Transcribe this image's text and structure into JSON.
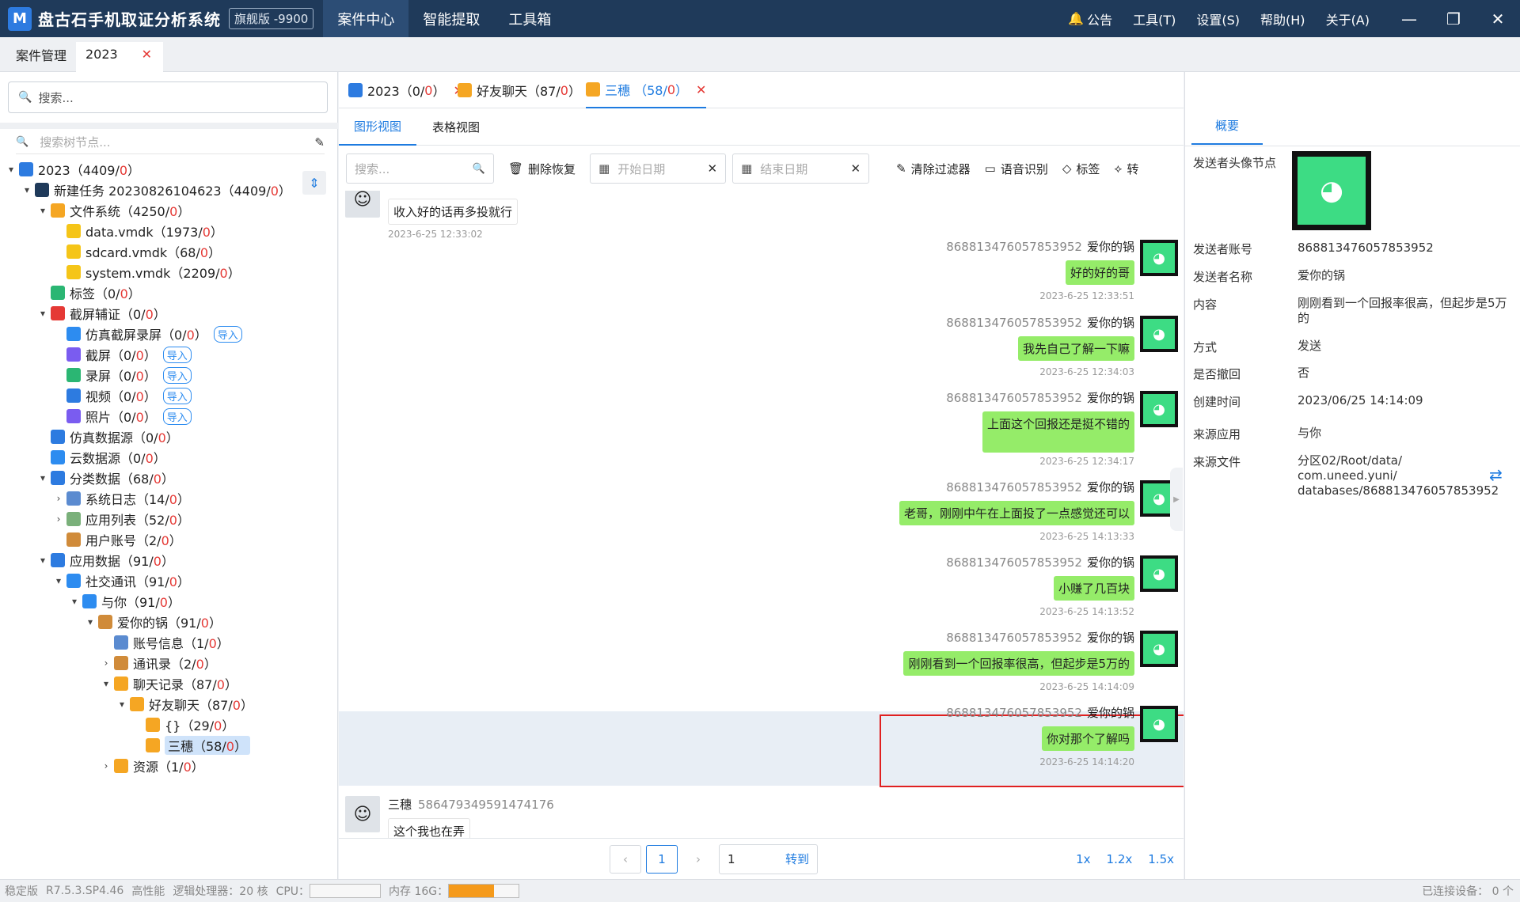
{
  "app": {
    "logo": "M",
    "name": "盘古石手机取证分析系统",
    "edition": "旗舰版 -9900"
  },
  "topmenu": [
    "案件中心",
    "智能提取",
    "工具箱"
  ],
  "rightmenu": {
    "notice": "公告",
    "tools": "工具(T)",
    "settings": "设置(S)",
    "help": "帮助(H)",
    "about": "关于(A)"
  },
  "casetabs": {
    "manage": "案件管理",
    "current": "2023"
  },
  "left": {
    "search_placeholder": "搜索...",
    "tree_search_placeholder": "搜索树节点..."
  },
  "tree": [
    {
      "label": "2023（4409/",
      "red": "0",
      "end": "）",
      "level": 0,
      "arrow": "v",
      "icon": "#2d7be0"
    },
    {
      "label": "新建任务 20230826104623（4409/",
      "red": "0",
      "end": "）",
      "level": 1,
      "arrow": "v",
      "icon": "#1f3a5a"
    },
    {
      "label": "文件系统（4250/",
      "red": "0",
      "end": "）",
      "level": 2,
      "arrow": "v",
      "icon": "#f5a623"
    },
    {
      "label": "data.vmdk（1973/",
      "red": "0",
      "end": "）",
      "level": 3,
      "arrow": "",
      "icon": "#f5c518"
    },
    {
      "label": "sdcard.vmdk（68/",
      "red": "0",
      "end": "）",
      "level": 3,
      "arrow": "",
      "icon": "#f5c518"
    },
    {
      "label": "system.vmdk（2209/",
      "red": "0",
      "end": "）",
      "level": 3,
      "arrow": "",
      "icon": "#f5c518"
    },
    {
      "label": "标签（0/",
      "red": "0",
      "end": "）",
      "level": 2,
      "arrow": "",
      "icon": "#2bb673"
    },
    {
      "label": "截屏辅证（0/",
      "red": "0",
      "end": "）",
      "level": 2,
      "arrow": "v",
      "icon": "#e53935"
    },
    {
      "label": "仿真截屏录屏（0/",
      "red": "0",
      "end": "）",
      "level": 3,
      "arrow": "",
      "icon": "#2d8cf0",
      "tag": "导入"
    },
    {
      "label": "截屏（0/",
      "red": "0",
      "end": "）",
      "level": 3,
      "arrow": "",
      "icon": "#7a5cf0",
      "tag": "导入"
    },
    {
      "label": "录屏（0/",
      "red": "0",
      "end": "）",
      "level": 3,
      "arrow": "",
      "icon": "#2bb673",
      "tag": "导入"
    },
    {
      "label": "视频（0/",
      "red": "0",
      "end": "）",
      "level": 3,
      "arrow": "",
      "icon": "#2d7be0",
      "tag": "导入"
    },
    {
      "label": "照片（0/",
      "red": "0",
      "end": "）",
      "level": 3,
      "arrow": "",
      "icon": "#7a5cf0",
      "tag": "导入"
    },
    {
      "label": "仿真数据源（0/",
      "red": "0",
      "end": "）",
      "level": 2,
      "arrow": "",
      "icon": "#2d7be0"
    },
    {
      "label": "云数据源（0/",
      "red": "0",
      "end": "）",
      "level": 2,
      "arrow": "",
      "icon": "#2d8cf0"
    },
    {
      "label": "分类数据（68/",
      "red": "0",
      "end": "）",
      "level": 2,
      "arrow": "v",
      "icon": "#2d7be0"
    },
    {
      "label": "系统日志（14/",
      "red": "0",
      "end": "）",
      "level": 3,
      "arrow": ">",
      "icon": "#5b8bd0"
    },
    {
      "label": "应用列表（52/",
      "red": "0",
      "end": "）",
      "level": 3,
      "arrow": ">",
      "icon": "#7ab07a"
    },
    {
      "label": "用户账号（2/",
      "red": "0",
      "end": "）",
      "level": 3,
      "arrow": "",
      "icon": "#d08b3a"
    },
    {
      "label": "应用数据（91/",
      "red": "0",
      "end": "）",
      "level": 2,
      "arrow": "v",
      "icon": "#2d7be0"
    },
    {
      "label": "社交通讯（91/",
      "red": "0",
      "end": "）",
      "level": 3,
      "arrow": "v",
      "icon": "#2d8cf0"
    },
    {
      "label": "与你（91/",
      "red": "0",
      "end": "）",
      "level": 4,
      "arrow": "v",
      "icon": "#2d8cf0"
    },
    {
      "label": "爱你的锅（91/",
      "red": "0",
      "end": "）",
      "level": 5,
      "arrow": "v",
      "icon": "#d08b3a"
    },
    {
      "label": "账号信息（1/",
      "red": "0",
      "end": "）",
      "level": 6,
      "arrow": "",
      "icon": "#5b8bd0"
    },
    {
      "label": "通讯录（2/",
      "red": "0",
      "end": "）",
      "level": 6,
      "arrow": ">",
      "icon": "#d08b3a"
    },
    {
      "label": "聊天记录（87/",
      "red": "0",
      "end": "）",
      "level": 6,
      "arrow": "v",
      "icon": "#f5a623"
    },
    {
      "label": "好友聊天（87/",
      "red": "0",
      "end": "）",
      "level": 7,
      "arrow": "v",
      "icon": "#f5a623"
    },
    {
      "label": "{}（29/",
      "red": "0",
      "end": "）",
      "level": 8,
      "arrow": "",
      "icon": "#f5a623"
    },
    {
      "label": "三穗（58/",
      "red": "0",
      "end": "）",
      "level": 8,
      "arrow": "",
      "icon": "#f5a623",
      "selected": true
    },
    {
      "label": "资源（1/",
      "red": "0",
      "end": "）",
      "level": 6,
      "arrow": ">",
      "icon": "#f5a623"
    }
  ],
  "doctabs": [
    {
      "label": "2023（0/",
      "red": "0",
      "end": "）"
    },
    {
      "label": "好友聊天（87/",
      "red": "0",
      "end": "）"
    },
    {
      "label": "三穗 （58/",
      "red": "0",
      "end": "）"
    }
  ],
  "viewtabs": [
    "图形视图",
    "表格视图"
  ],
  "toolbar": {
    "search_placeholder": "搜索...",
    "delete_recover": "删除恢复",
    "start_date": "开始日期",
    "end_date": "结束日期",
    "clear_filter": "清除过滤器",
    "speech": "语音识别",
    "tag": "标签",
    "convert": "转"
  },
  "messages": [
    {
      "side": "left",
      "text": "收入好的话再多投就行",
      "time": "2023-6-25 12:33:02"
    },
    {
      "side": "right",
      "account": "868813476057853952",
      "name": "爱你的锅",
      "text": "好的好的哥",
      "time": "2023-6-25 12:33:51"
    },
    {
      "side": "right",
      "account": "868813476057853952",
      "name": "爱你的锅",
      "text": "我先自己了解一下嘛",
      "time": "2023-6-25 12:34:03"
    },
    {
      "side": "right",
      "account": "868813476057853952",
      "name": "爱你的锅",
      "text": "上面这个回报还是挺不错的",
      "time": "2023-6-25 12:34:17"
    },
    {
      "side": "right",
      "account": "868813476057853952",
      "name": "爱你的锅",
      "text": "老哥，刚刚中午在上面投了一点感觉还可以",
      "time": "2023-6-25 14:13:33"
    },
    {
      "side": "right",
      "account": "868813476057853952",
      "name": "爱你的锅",
      "text": "小赚了几百块",
      "time": "2023-6-25 14:13:52"
    },
    {
      "side": "right",
      "account": "868813476057853952",
      "name": "爱你的锅",
      "text": "刚刚看到一个回报率很高，但起步是5万的",
      "time": "2023-6-25 14:14:09"
    },
    {
      "side": "right",
      "account": "868813476057853952",
      "name": "爱你的锅",
      "text": "你对那个了解吗",
      "time": "2023-6-25 14:14:20"
    },
    {
      "side": "left",
      "account": "586479349591474176",
      "name": "三穗",
      "text": "这个我也在弄",
      "time": ""
    }
  ],
  "pager": {
    "page": "1",
    "goto_value": "1",
    "goto_label": "转到",
    "zoom": [
      "1x",
      "1.2x",
      "1.5x"
    ]
  },
  "detail": {
    "tab": "概要",
    "rows": [
      {
        "label": "发送者头像节点",
        "value": ""
      },
      {
        "label": "发送者账号",
        "value": "868813476057853952"
      },
      {
        "label": "发送者名称",
        "value": "爱你的锅"
      },
      {
        "label": "内容",
        "value": "刚刚看到一个回报率很高，但起步是5万的"
      },
      {
        "label": "方式",
        "value": "发送"
      },
      {
        "label": "是否撤回",
        "value": "否"
      },
      {
        "label": "创建时间",
        "value": "2023/06/25 14:14:09"
      },
      {
        "label": "来源应用",
        "value": "与你"
      },
      {
        "label": "来源文件",
        "value": "分区02/Root/data/\ncom.uneed.yuni/\ndatabases/868813476057853952"
      }
    ]
  },
  "status": {
    "version": "稳定版",
    "build": "R7.5.3.SP4.46",
    "perf": "高性能",
    "cpu_logic": "逻辑处理器：20 核",
    "cpu": "CPU：",
    "mem": "内存 16G：",
    "mem_level": 0.65,
    "connected": "已连接设备： 0 个"
  }
}
